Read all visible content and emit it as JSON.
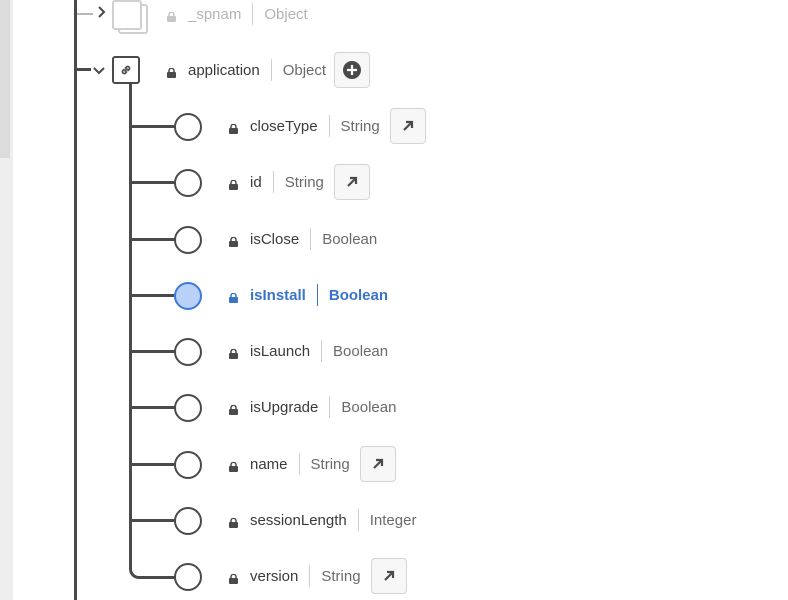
{
  "colors": {
    "line": "#4a4a4a",
    "selected_fill": "#b9d1f7",
    "selected_text": "#3a74c9",
    "faded_text": "#b3b3b3"
  },
  "rows": {
    "spnam": {
      "name": "_spnam",
      "type": "Object"
    },
    "application": {
      "name": "application",
      "type": "Object",
      "icon": "link-icon",
      "action": "add-icon"
    },
    "fields": [
      {
        "name": "closeType",
        "type": "String",
        "action": "arrow-up-right-icon"
      },
      {
        "name": "id",
        "type": "String",
        "action": "arrow-up-right-icon"
      },
      {
        "name": "isClose",
        "type": "Boolean"
      },
      {
        "name": "isInstall",
        "type": "Boolean",
        "selected": true
      },
      {
        "name": "isLaunch",
        "type": "Boolean"
      },
      {
        "name": "isUpgrade",
        "type": "Boolean"
      },
      {
        "name": "name",
        "type": "String",
        "action": "arrow-up-right-icon"
      },
      {
        "name": "sessionLength",
        "type": "Integer"
      },
      {
        "name": "version",
        "type": "String",
        "action": "arrow-up-right-icon"
      }
    ]
  }
}
